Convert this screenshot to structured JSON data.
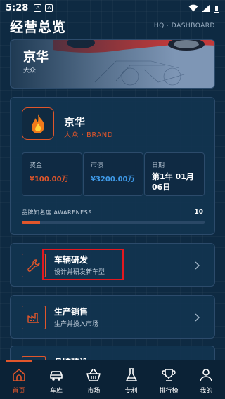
{
  "status_bar": {
    "time": "5:28",
    "icon_1": "A",
    "icon_2": "A"
  },
  "header": {
    "title": "经营总览",
    "subtitle": "HQ · DASHBOARD"
  },
  "hero": {
    "name": "京华",
    "brand": "大众"
  },
  "brand_card": {
    "name": "京华",
    "sub": "大众 · BRAND",
    "logo_icon": "flame-icon",
    "stats": [
      {
        "label": "资金",
        "value": "¥100.00万"
      },
      {
        "label": "市债",
        "value": "¥3200.00万"
      },
      {
        "label": "日期",
        "value": "第1年 01月 06日"
      }
    ],
    "awareness": {
      "label": "品牌知名度 AWARENESS",
      "value_text": "10",
      "value": 10
    }
  },
  "menu": [
    {
      "title": "车辆研发",
      "desc": "设计并研发新车型",
      "icon": "wrench-icon"
    },
    {
      "title": "生产销售",
      "desc": "生产并投入市场",
      "icon": "factory-icon"
    },
    {
      "title": "品牌建设",
      "desc": "",
      "icon": "flag-icon"
    }
  ],
  "nav": [
    {
      "label": "首页",
      "icon": "home-icon",
      "active": true
    },
    {
      "label": "车库",
      "icon": "car-icon"
    },
    {
      "label": "市场",
      "icon": "basket-icon"
    },
    {
      "label": "专利",
      "icon": "flask-icon"
    },
    {
      "label": "排行榜",
      "icon": "trophy-icon"
    },
    {
      "label": "我的",
      "icon": "user-icon"
    }
  ],
  "colors": {
    "accent": "#e0562b",
    "debt": "#3f9ae8",
    "background": "#0e2a42",
    "card": "#123450",
    "highlight": "#e3181f"
  }
}
